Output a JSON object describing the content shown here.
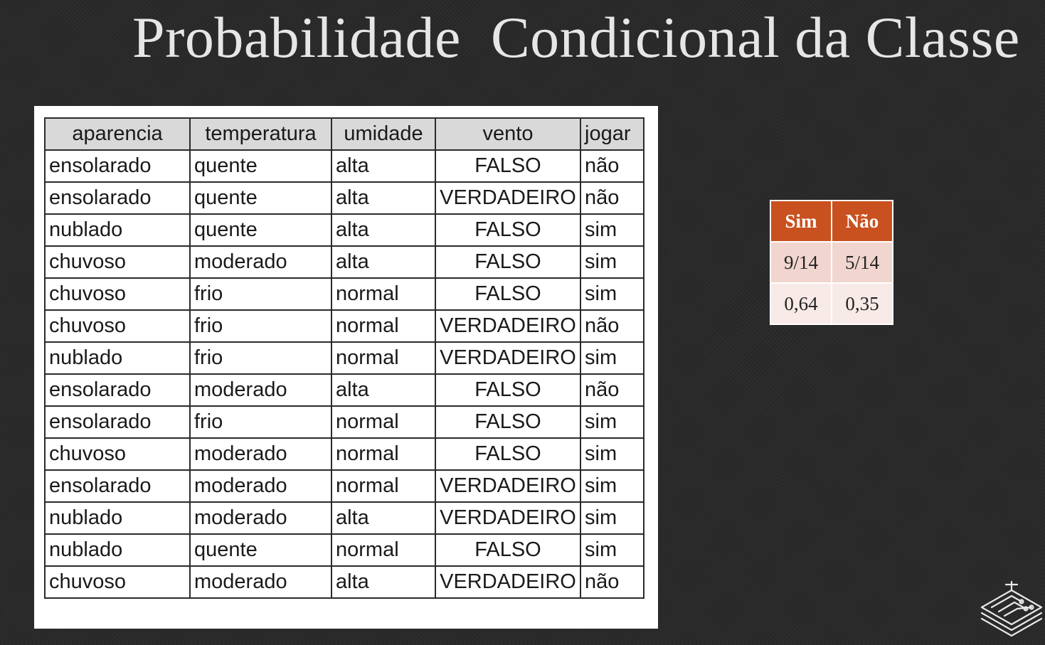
{
  "title": "Probabilidade  Condicional da Classe",
  "table": {
    "headers": [
      "aparencia",
      "temperatura",
      "umidade",
      "vento",
      "jogar"
    ],
    "rows": [
      [
        "ensolarado",
        "quente",
        "alta",
        "FALSO",
        "não"
      ],
      [
        "ensolarado",
        "quente",
        "alta",
        "VERDADEIRO",
        "não"
      ],
      [
        "nublado",
        "quente",
        "alta",
        "FALSO",
        "sim"
      ],
      [
        "chuvoso",
        "moderado",
        "alta",
        "FALSO",
        "sim"
      ],
      [
        "chuvoso",
        "frio",
        "normal",
        "FALSO",
        "sim"
      ],
      [
        "chuvoso",
        "frio",
        "normal",
        "VERDADEIRO",
        "não"
      ],
      [
        "nublado",
        "frio",
        "normal",
        "VERDADEIRO",
        "sim"
      ],
      [
        "ensolarado",
        "moderado",
        "alta",
        "FALSO",
        "não"
      ],
      [
        "ensolarado",
        "frio",
        "normal",
        "FALSO",
        "sim"
      ],
      [
        "chuvoso",
        "moderado",
        "normal",
        "FALSO",
        "sim"
      ],
      [
        "ensolarado",
        "moderado",
        "normal",
        "VERDADEIRO",
        "sim"
      ],
      [
        "nublado",
        "moderado",
        "alta",
        "VERDADEIRO",
        "sim"
      ],
      [
        "nublado",
        "quente",
        "normal",
        "FALSO",
        "sim"
      ],
      [
        "chuvoso",
        "moderado",
        "alta",
        "VERDADEIRO",
        "não"
      ]
    ]
  },
  "class_prob": {
    "headers": [
      "Sim",
      "Não"
    ],
    "fractions": [
      "9/14",
      "5/14"
    ],
    "decimals": [
      "0,64",
      "0,35"
    ]
  },
  "colors": {
    "background": "#2a2a2a",
    "accent": "#c8511f",
    "title": "#e6e6e6"
  },
  "icons": {
    "corner_logo": "circuit-book-icon"
  }
}
